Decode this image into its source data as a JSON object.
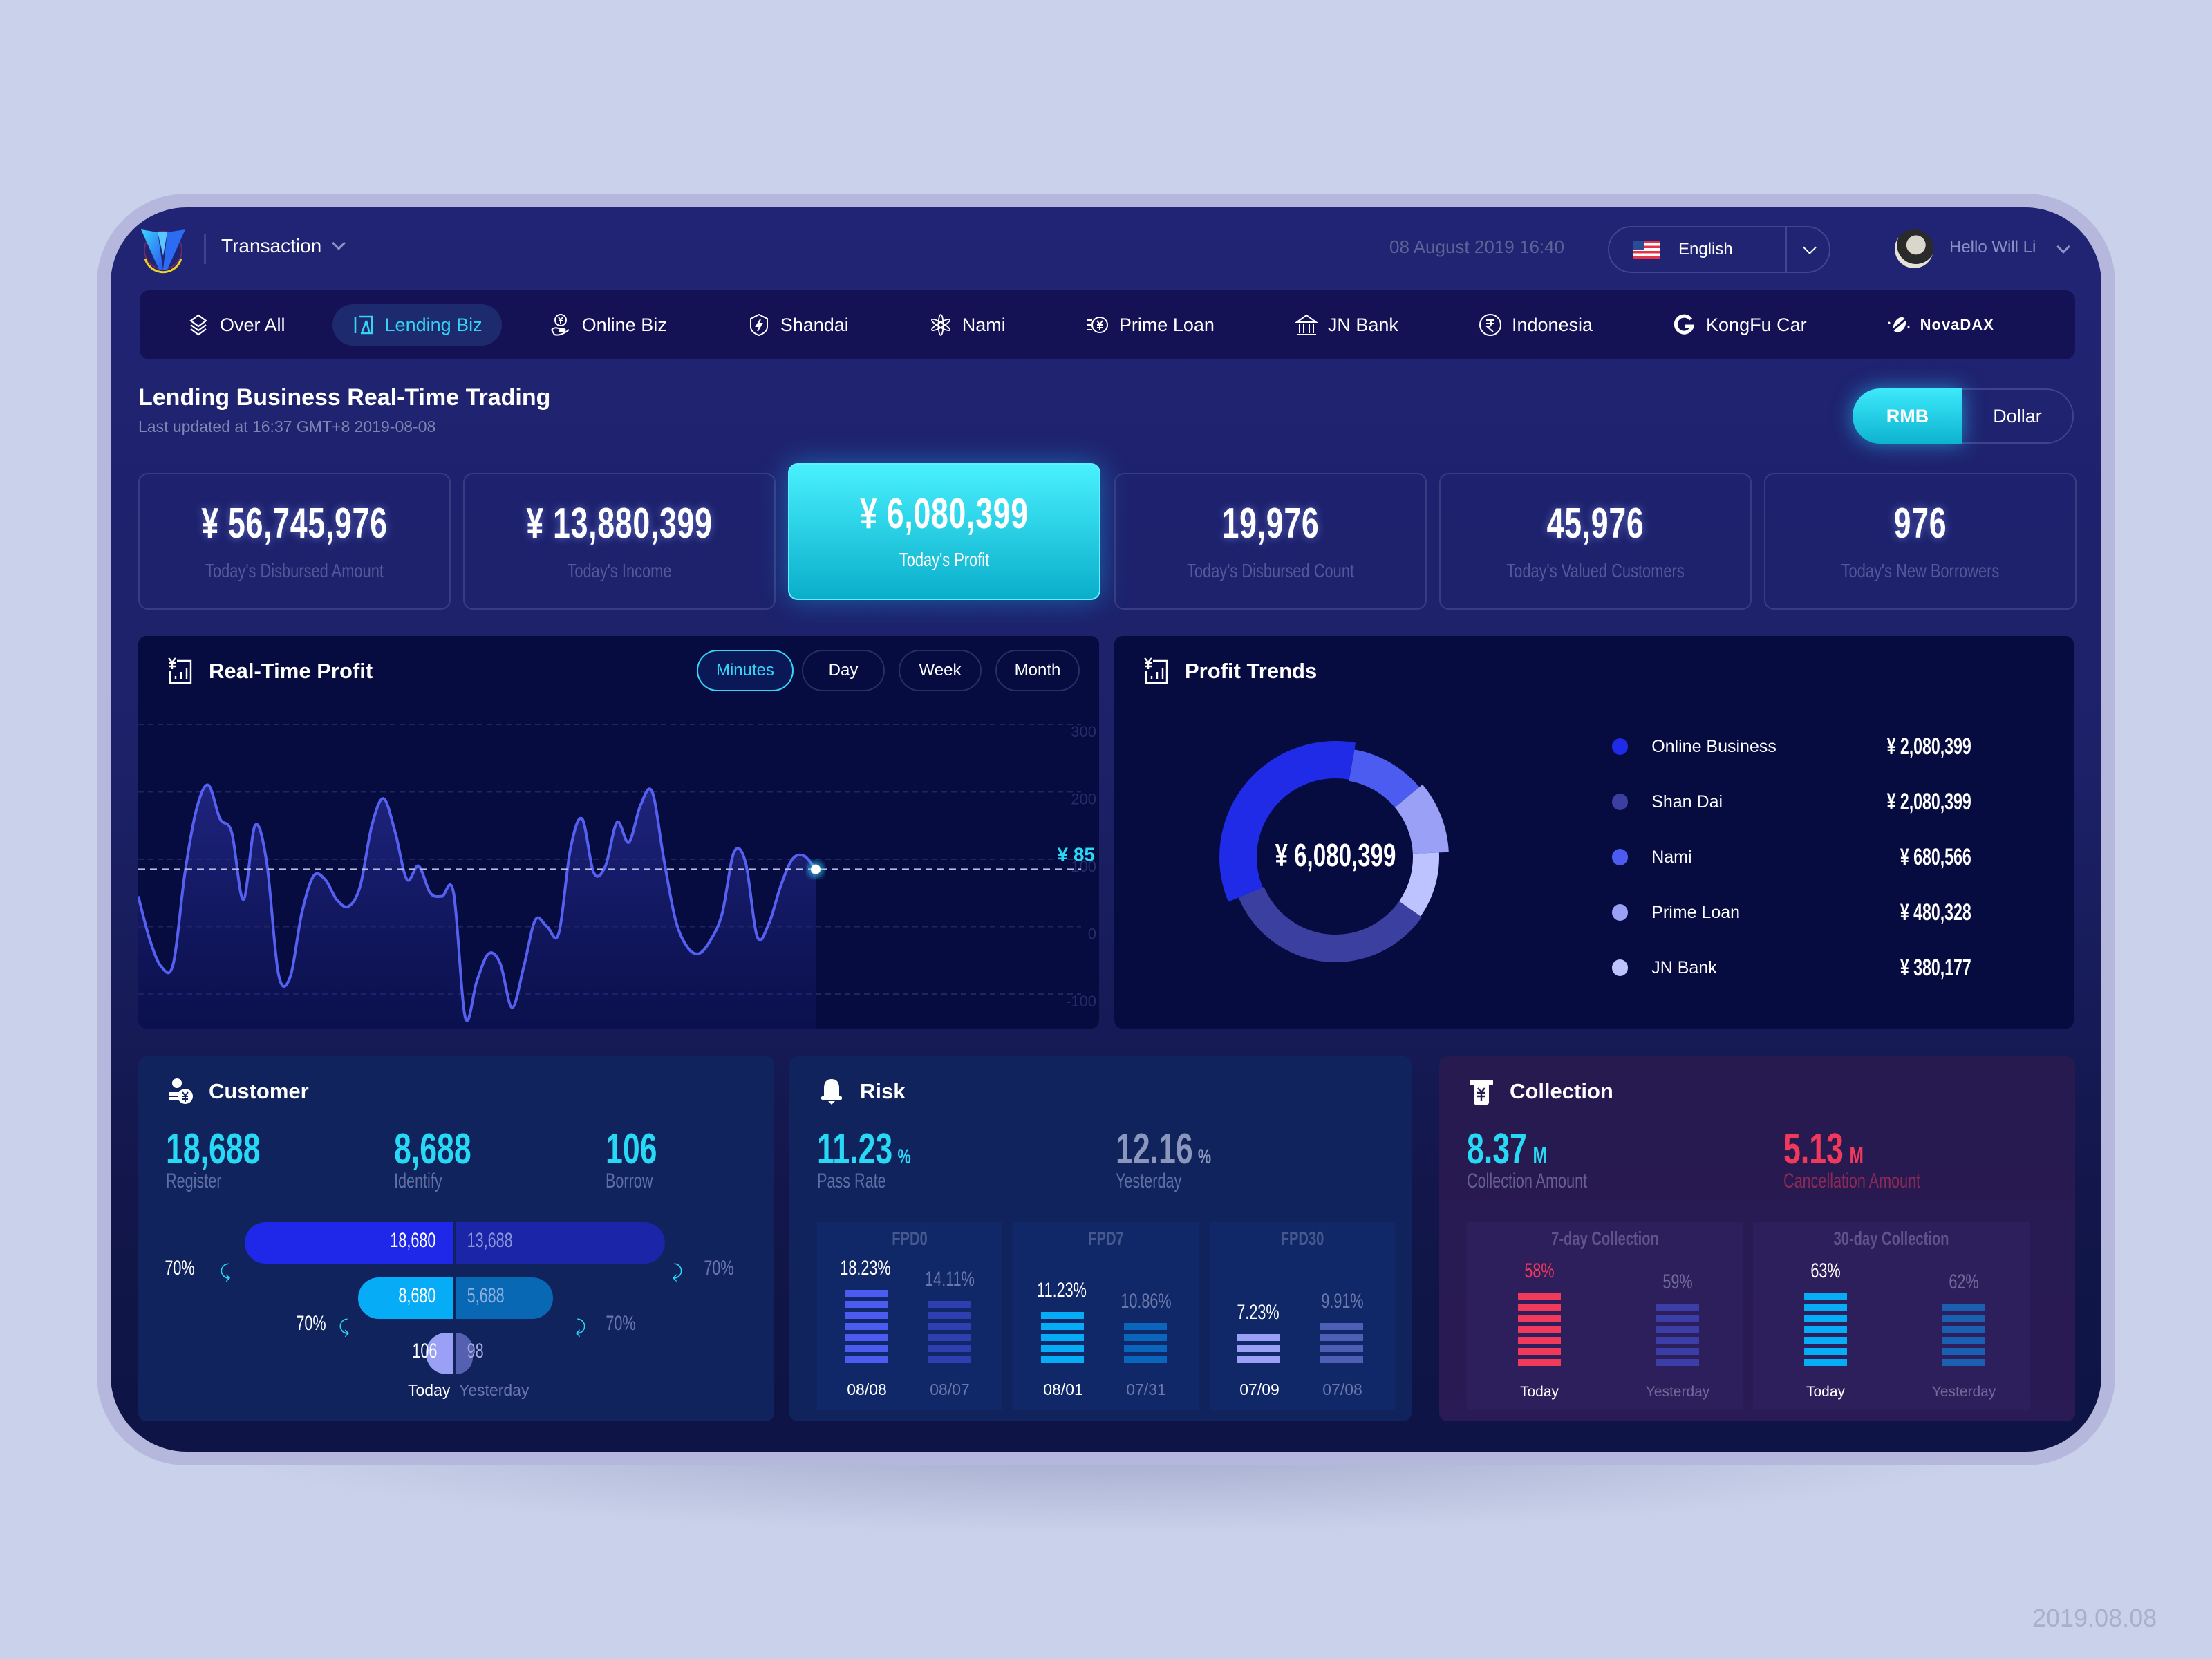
{
  "header": {
    "app_menu": "Transaction",
    "datetime": "08 August 2019 16:40",
    "language": "English",
    "greeting": "Hello Will Li"
  },
  "nav": [
    {
      "label": "Over All",
      "icon": "layers-icon",
      "active": false
    },
    {
      "label": "Lending Biz",
      "icon": "lending-icon",
      "active": true
    },
    {
      "label": "Online Biz",
      "icon": "yuan-hand-icon",
      "active": false
    },
    {
      "label": "Shandai",
      "icon": "lightning-shield-icon",
      "active": false
    },
    {
      "label": "Nami",
      "icon": "flower-icon",
      "active": false
    },
    {
      "label": "Prime Loan",
      "icon": "fast-yuan-icon",
      "active": false
    },
    {
      "label": "JN Bank",
      "icon": "bank-icon",
      "active": false
    },
    {
      "label": "Indonesia",
      "icon": "rupee-icon",
      "active": false
    },
    {
      "label": "KongFu Car",
      "icon": "g-logo-icon",
      "active": false
    },
    {
      "label": "NovaDAX",
      "icon": "novadax-logo-icon",
      "active": false
    }
  ],
  "page": {
    "title": "Lending Business Real-Time Trading",
    "updated": "Last updated at 16:37 GMT+8 2019-08-08",
    "currency": [
      {
        "label": "RMB",
        "active": true
      },
      {
        "label": "Dollar",
        "active": false
      }
    ]
  },
  "kpis": [
    {
      "value": "¥ 56,745,976",
      "label": "Today's Disbursed Amount",
      "highlight": false
    },
    {
      "value": "¥ 13,880,399",
      "label": "Today's Income",
      "highlight": false
    },
    {
      "value": "¥ 6,080,399",
      "label": "Today's Profit",
      "highlight": true
    },
    {
      "value": "19,976",
      "label": "Today's Disbursed Count",
      "highlight": false
    },
    {
      "value": "45,976",
      "label": "Today's Valued Customers",
      "highlight": false
    },
    {
      "value": "976",
      "label": "Today's New Borrowers",
      "highlight": false
    }
  ],
  "realtime": {
    "title": "Real-Time Profit",
    "ranges": [
      {
        "label": "Minutes",
        "active": true
      },
      {
        "label": "Day"
      },
      {
        "label": "Week"
      },
      {
        "label": "Month"
      }
    ],
    "current_label": "¥ 85"
  },
  "trends": {
    "title": "Profit Trends",
    "total": "¥ 6,080,399",
    "items": [
      {
        "name": "Online Business",
        "value": "¥ 2,080,399",
        "color": "#1f2be6"
      },
      {
        "name": "Shan Dai",
        "value": "¥ 2,080,399",
        "color": "#3a3fa0"
      },
      {
        "name": "Nami",
        "value": "¥ 680,566",
        "color": "#4d5cf0"
      },
      {
        "name": "Prime Loan",
        "value": "¥ 480,328",
        "color": "#9aa0f5"
      },
      {
        "name": "JN Bank",
        "value": "¥ 380,177",
        "color": "#bcc3ff"
      }
    ]
  },
  "chart_data": [
    {
      "type": "area",
      "title": "Real-Time Profit",
      "ylim": [
        -100,
        300
      ],
      "yticks": [
        "300",
        "200",
        "100",
        "0",
        "-100"
      ],
      "grid": true,
      "current_value": 85,
      "y": [
        45,
        -20,
        -60,
        -55,
        80,
        175,
        210,
        160,
        140,
        40,
        150,
        95,
        -70,
        -75,
        20,
        75,
        70,
        40,
        30,
        60,
        150,
        190,
        140,
        70,
        90,
        50,
        45,
        50,
        -135,
        -80,
        -40,
        -55,
        -120,
        -60,
        10,
        0,
        -10,
        115,
        160,
        80,
        90,
        155,
        125,
        180,
        200,
        100,
        10,
        -30,
        -40,
        -20,
        20,
        110,
        95,
        -15,
        5,
        60,
        100,
        105,
        85
      ]
    },
    {
      "type": "pie",
      "title": "Profit Trends",
      "categories": [
        "Online Business",
        "Shan Dai",
        "Nami",
        "Prime Loan",
        "JN Bank"
      ],
      "values": [
        2080399,
        2080399,
        680566,
        480328,
        380177
      ]
    }
  ],
  "customer": {
    "title": "Customer",
    "stats": [
      {
        "value": "18,688",
        "label": "Register"
      },
      {
        "value": "8,688",
        "label": "Identify"
      },
      {
        "value": "106",
        "label": "Borrow"
      }
    ],
    "funnel": [
      {
        "today": "18,680",
        "yesterday": "13,688"
      },
      {
        "today": "8,680",
        "yesterday": "5,688"
      },
      {
        "today": "106",
        "yesterday": "98"
      }
    ],
    "conversion_today": [
      "70%",
      "70%"
    ],
    "conversion_yesterday": [
      "70%",
      "70%"
    ],
    "legend_today": "Today",
    "legend_yesterday": "Yesterday"
  },
  "risk": {
    "title": "Risk",
    "pass_rate": "11.23",
    "pass_rate_label": "Pass Rate",
    "yesterday": "12.16",
    "yesterday_label": "Yesterday",
    "unit": "%",
    "groups": [
      {
        "name": "FPD0",
        "a_pct": "18.23%",
        "a_date": "08/08",
        "a_bars": 7,
        "b_pct": "14.11%",
        "b_date": "08/07",
        "b_bars": 6,
        "a_color": "#4d5cf0",
        "b_color": "#2f3fb0"
      },
      {
        "name": "FPD7",
        "a_pct": "11.23%",
        "a_date": "08/01",
        "a_bars": 5,
        "b_pct": "10.86%",
        "b_date": "07/31",
        "b_bars": 4,
        "a_color": "#07acf7",
        "b_color": "#0a66bc"
      },
      {
        "name": "FPD30",
        "a_pct": "7.23%",
        "a_date": "07/09",
        "a_bars": 3,
        "b_pct": "9.91%",
        "b_date": "07/08",
        "b_bars": 4,
        "a_color": "#9aa0f5",
        "b_color": "#4f5eb5"
      }
    ]
  },
  "collection": {
    "title": "Collection",
    "amount": "8.37",
    "amount_label": "Collection Amount",
    "cancel": "5.13",
    "cancel_label": "Cancellation Amount",
    "unit": "M",
    "groups": [
      {
        "name": "7-day Collection",
        "a_pct": "58%",
        "a_label": "Today",
        "a_bars": 7,
        "b_pct": "59%",
        "b_label": "Yesterday",
        "b_bars": 6,
        "a_color": "#f1395b",
        "b_color": "#3b3ea6",
        "a_text": "#f1395b"
      },
      {
        "name": "30-day Collection",
        "a_pct": "63%",
        "a_label": "Today",
        "a_bars": 7,
        "b_pct": "62%",
        "b_label": "Yesterday",
        "b_bars": 6,
        "a_color": "#07acf7",
        "b_color": "#1a5fb0",
        "a_text": "#ffffff"
      }
    ]
  },
  "watermark": "2019.08.08"
}
